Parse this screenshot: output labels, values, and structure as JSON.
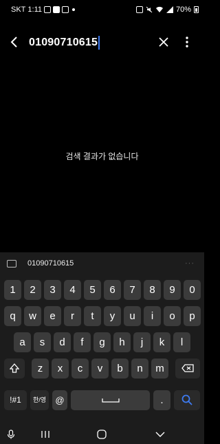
{
  "status": {
    "carrier": "SKT",
    "time": "1:11",
    "battery": "70%"
  },
  "search": {
    "query": "01090710615"
  },
  "empty_message": "검색 결과가 없습니다",
  "keyboard": {
    "suggestion": "01090710615",
    "row1": [
      "1",
      "2",
      "3",
      "4",
      "5",
      "6",
      "7",
      "8",
      "9",
      "0"
    ],
    "row2": [
      "q",
      "w",
      "e",
      "r",
      "t",
      "y",
      "u",
      "i",
      "o",
      "p"
    ],
    "row3": [
      "a",
      "s",
      "d",
      "f",
      "g",
      "h",
      "j",
      "k",
      "l"
    ],
    "row4": [
      "z",
      "x",
      "c",
      "v",
      "b",
      "n",
      "m"
    ],
    "symbols_label": "!#1",
    "lang_label": "한/영",
    "at_label": "@",
    "period_label": "."
  },
  "colors": {
    "accent": "#3e7bf2",
    "key": "#3b3b3b",
    "keyboard_bg": "#1c1c1c"
  }
}
